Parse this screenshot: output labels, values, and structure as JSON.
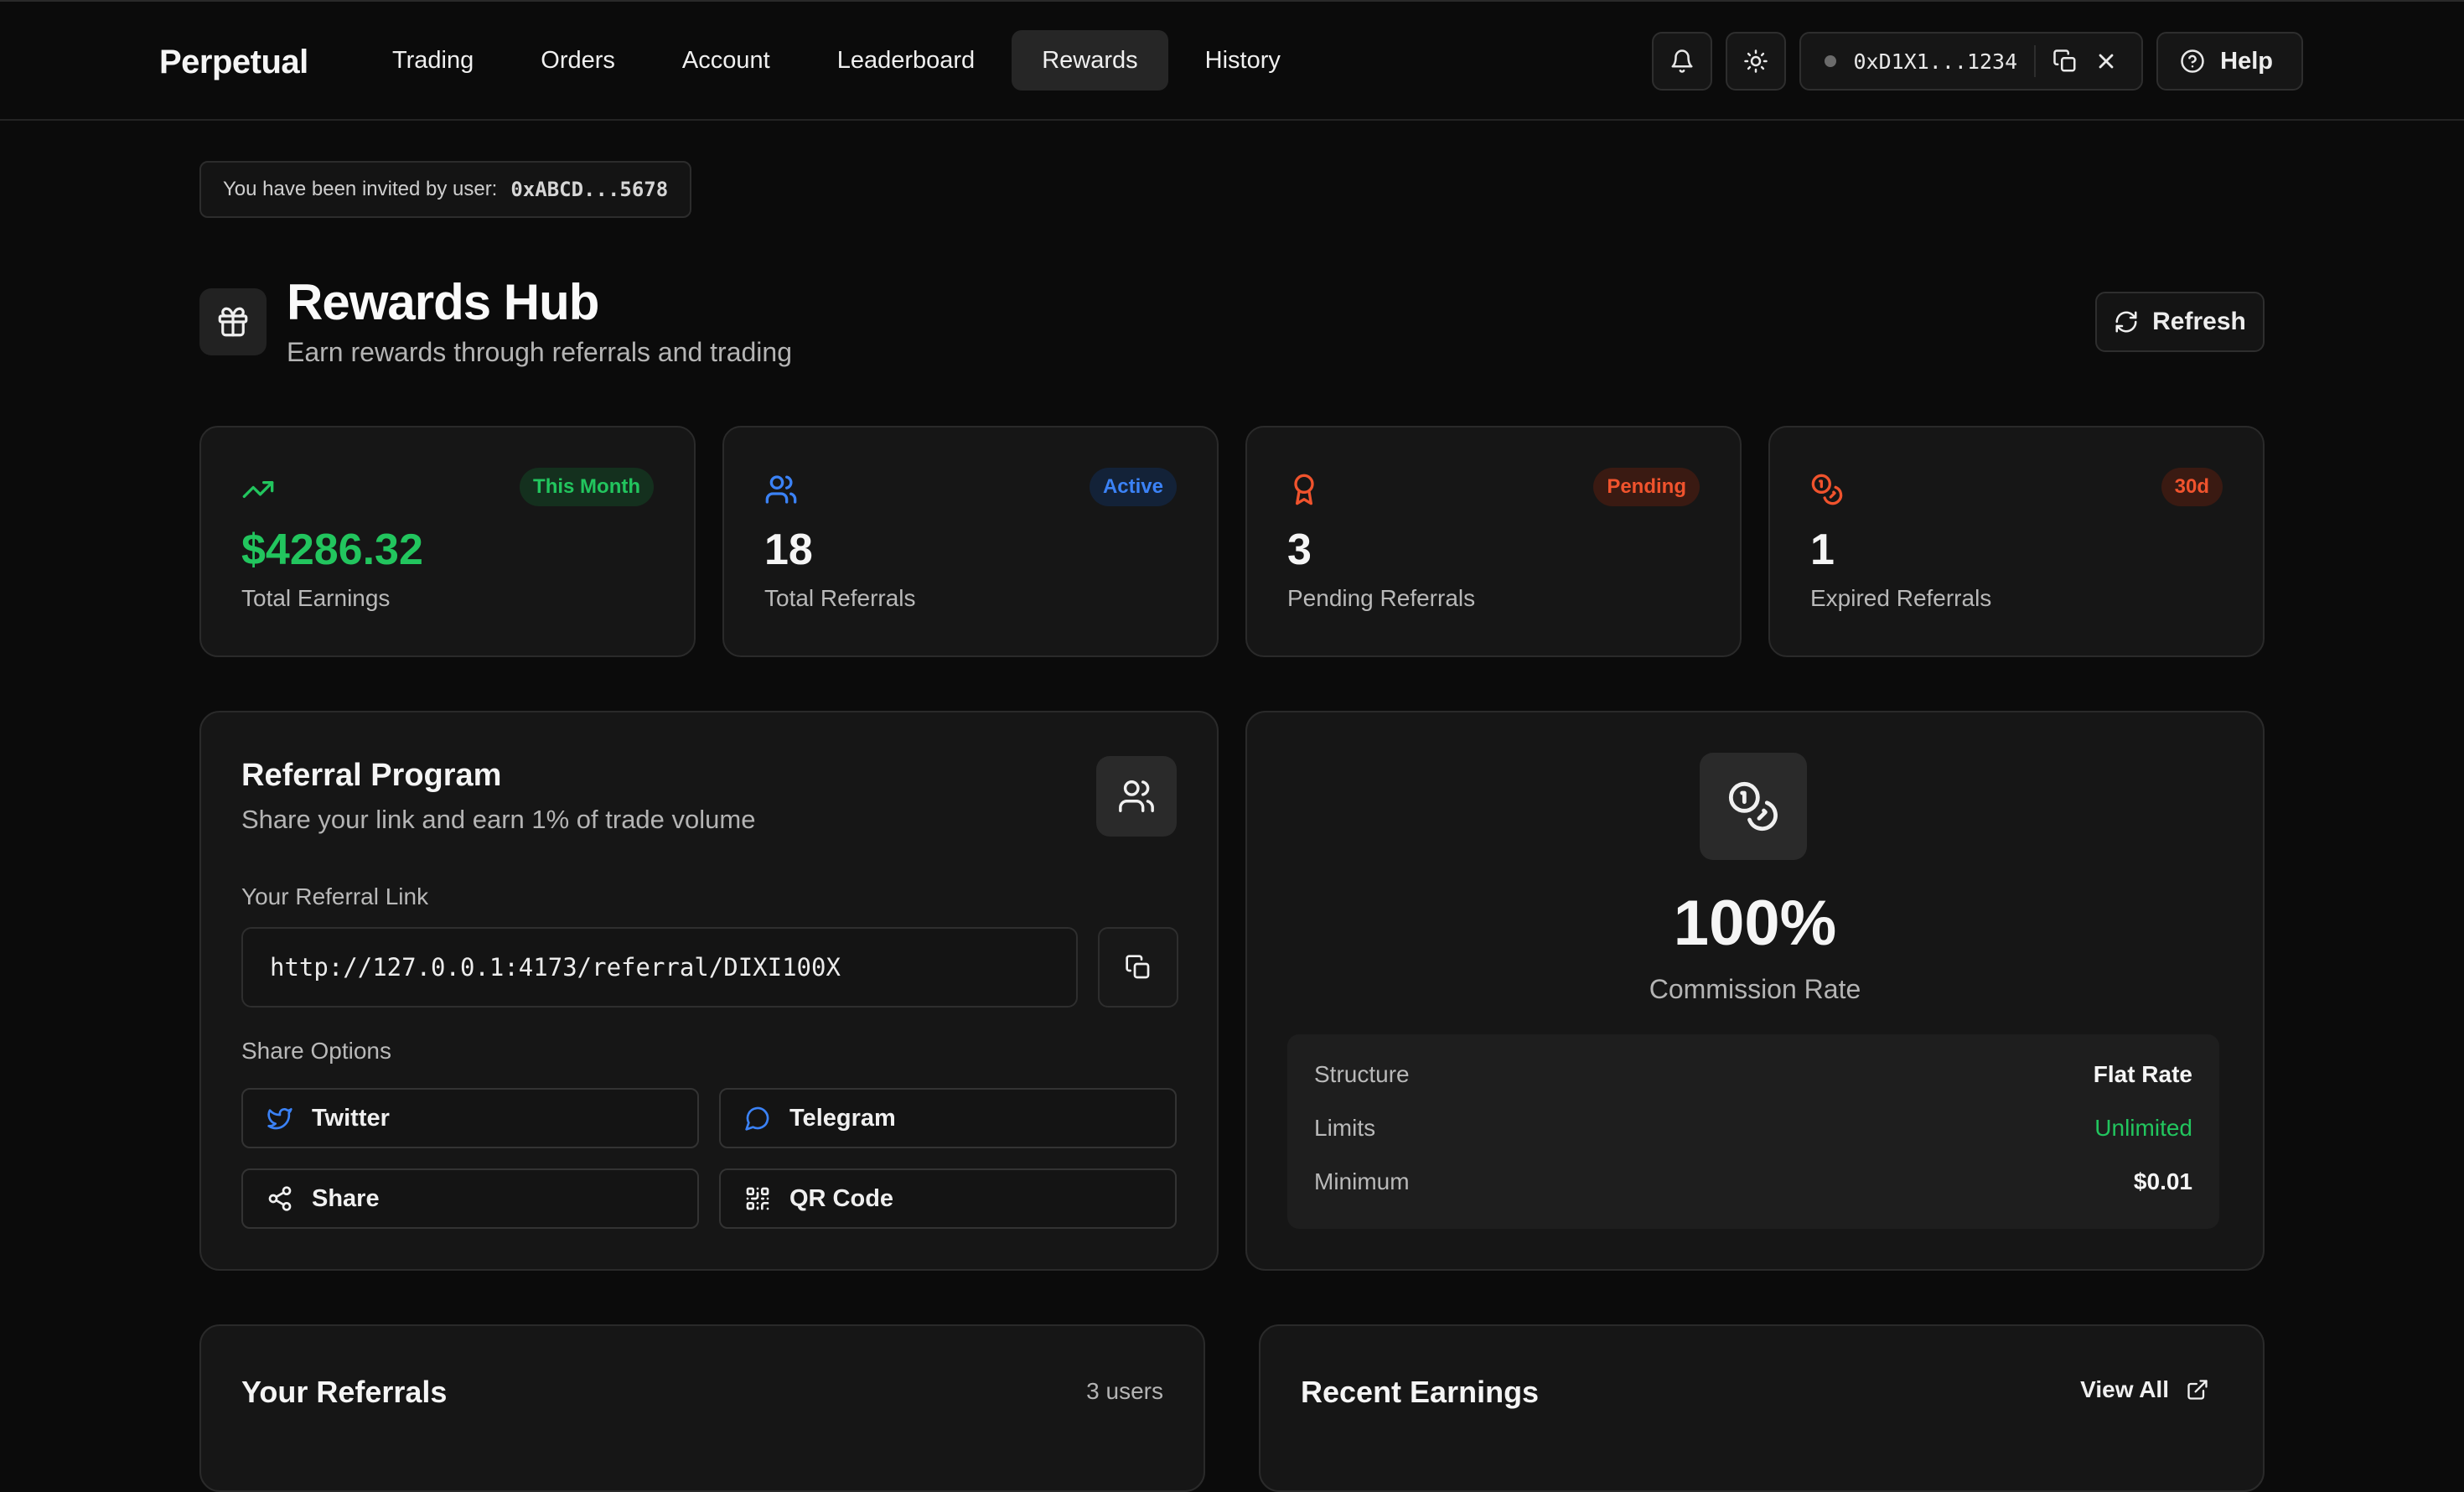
{
  "brand": "Perpetual",
  "nav": {
    "items": [
      {
        "label": "Trading"
      },
      {
        "label": "Orders"
      },
      {
        "label": "Account"
      },
      {
        "label": "Leaderboard"
      },
      {
        "label": "Rewards"
      },
      {
        "label": "History"
      }
    ],
    "active": "Rewards"
  },
  "wallet": {
    "address": "0xD1X1...1234"
  },
  "help_label": "Help",
  "invite": {
    "text": "You have been invited by user:",
    "address": "0xABCD...5678"
  },
  "header": {
    "title": "Rewards Hub",
    "subtitle": "Earn rewards through referrals and trading",
    "refresh_label": "Refresh"
  },
  "stats": [
    {
      "icon": "trending-up-icon",
      "badge": "This Month",
      "value": "$4286.32",
      "label": "Total Earnings",
      "accent": "#22c55e"
    },
    {
      "icon": "users-icon",
      "badge": "Active",
      "value": "18",
      "label": "Total Referrals",
      "accent": "#3b82f6"
    },
    {
      "icon": "award-icon",
      "badge": "Pending",
      "value": "3",
      "label": "Pending Referrals",
      "accent": "#f0532d"
    },
    {
      "icon": "coins-icon",
      "badge": "30d",
      "value": "1",
      "label": "Expired Referrals",
      "accent": "#f0532d"
    }
  ],
  "referral": {
    "title": "Referral Program",
    "subtitle": "Share your link and earn 1% of trade volume",
    "link_label": "Your Referral Link",
    "link_value": "http://127.0.0.1:4173/referral/DIXI100X",
    "share_label": "Share Options",
    "share_buttons": [
      {
        "label": "Twitter",
        "icon": "twitter-icon"
      },
      {
        "label": "Telegram",
        "icon": "message-circle-icon"
      },
      {
        "label": "Share",
        "icon": "share-icon"
      },
      {
        "label": "QR Code",
        "icon": "qr-code-icon"
      }
    ]
  },
  "commission": {
    "rate": "100%",
    "label": "Commission Rate",
    "rows": [
      {
        "key": "Structure",
        "value": "Flat Rate"
      },
      {
        "key": "Limits",
        "value": "Unlimited"
      },
      {
        "key": "Minimum",
        "value": "$0.01"
      }
    ]
  },
  "your_referrals": {
    "title": "Your Referrals",
    "count": "3 users"
  },
  "recent_earnings": {
    "title": "Recent Earnings",
    "view_all": "View All"
  },
  "colors": {
    "green": "#22c55e",
    "blue": "#3b82f6",
    "orange": "#f0532d"
  }
}
